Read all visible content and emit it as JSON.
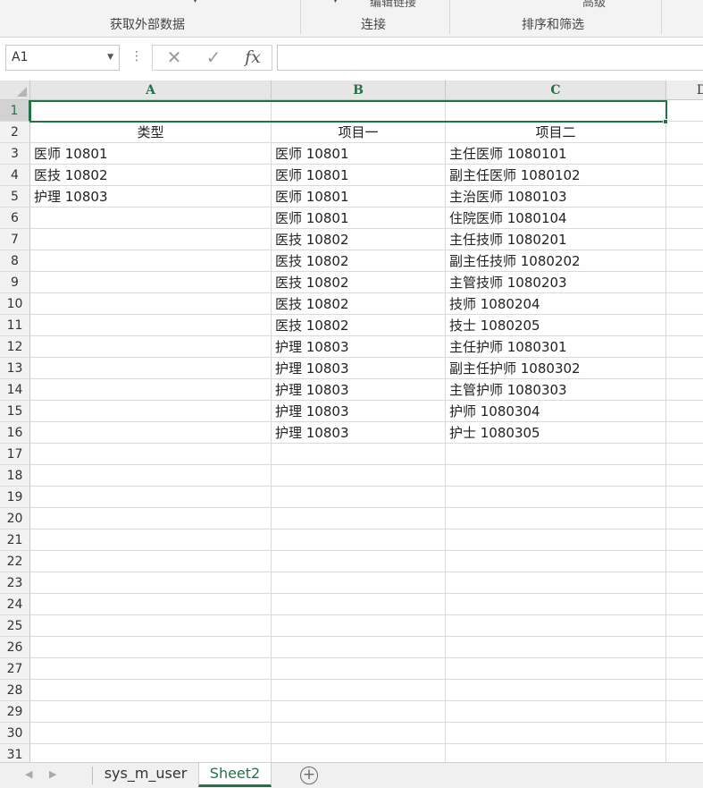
{
  "ribbon": {
    "groups": [
      {
        "label": "获取外部数据"
      },
      {
        "label": "连接"
      },
      {
        "label": "排序和筛选"
      }
    ],
    "cut_items": {
      "edit_links": "编辑链接",
      "advanced": "高级"
    }
  },
  "formula_bar": {
    "name_box": "A1",
    "cancel_icon": "close-icon",
    "enter_icon": "check-icon",
    "fx_label": "fx",
    "value": ""
  },
  "columns": [
    "A",
    "B",
    "C",
    "D"
  ],
  "rows": [
    {
      "num": "1",
      "A": "",
      "B": "",
      "C": ""
    },
    {
      "num": "2",
      "A": "类型",
      "B": "项目一",
      "C": "项目二"
    },
    {
      "num": "3",
      "A": "医师  10801",
      "B": "医师  10801",
      "C": "主任医师  1080101"
    },
    {
      "num": "4",
      "A": "医技  10802",
      "B": "医师  10801",
      "C": "副主任医师  1080102"
    },
    {
      "num": "5",
      "A": "护理  10803",
      "B": "医师  10801",
      "C": "主治医师  1080103"
    },
    {
      "num": "6",
      "A": "",
      "B": "医师  10801",
      "C": "住院医师  1080104"
    },
    {
      "num": "7",
      "A": "",
      "B": "医技  10802",
      "C": "主任技师  1080201"
    },
    {
      "num": "8",
      "A": "",
      "B": "医技  10802",
      "C": "副主任技师  1080202"
    },
    {
      "num": "9",
      "A": "",
      "B": "医技  10802",
      "C": "主管技师  1080203"
    },
    {
      "num": "10",
      "A": "",
      "B": "医技  10802",
      "C": "技师  1080204"
    },
    {
      "num": "11",
      "A": "",
      "B": "医技  10802",
      "C": "技士  1080205"
    },
    {
      "num": "12",
      "A": "",
      "B": "护理  10803",
      "C": "主任护师  1080301"
    },
    {
      "num": "13",
      "A": "",
      "B": "护理  10803",
      "C": "副主任护师  1080302"
    },
    {
      "num": "14",
      "A": "",
      "B": "护理  10803",
      "C": "主管护师  1080303"
    },
    {
      "num": "15",
      "A": "",
      "B": "护理  10803",
      "C": "护师  1080304"
    },
    {
      "num": "16",
      "A": "",
      "B": "护理  10803",
      "C": "护士  1080305"
    },
    {
      "num": "17",
      "A": "",
      "B": "",
      "C": ""
    },
    {
      "num": "18",
      "A": "",
      "B": "",
      "C": ""
    },
    {
      "num": "19",
      "A": "",
      "B": "",
      "C": ""
    },
    {
      "num": "20",
      "A": "",
      "B": "",
      "C": ""
    },
    {
      "num": "21",
      "A": "",
      "B": "",
      "C": ""
    },
    {
      "num": "22",
      "A": "",
      "B": "",
      "C": ""
    },
    {
      "num": "23",
      "A": "",
      "B": "",
      "C": ""
    },
    {
      "num": "24",
      "A": "",
      "B": "",
      "C": ""
    },
    {
      "num": "25",
      "A": "",
      "B": "",
      "C": ""
    },
    {
      "num": "26",
      "A": "",
      "B": "",
      "C": ""
    },
    {
      "num": "27",
      "A": "",
      "B": "",
      "C": ""
    },
    {
      "num": "28",
      "A": "",
      "B": "",
      "C": ""
    },
    {
      "num": "29",
      "A": "",
      "B": "",
      "C": ""
    },
    {
      "num": "30",
      "A": "",
      "B": "",
      "C": ""
    },
    {
      "num": "31",
      "A": "",
      "B": "",
      "C": ""
    }
  ],
  "sheet_tabs": [
    {
      "label": "sys_m_user",
      "active": false
    },
    {
      "label": "Sheet2",
      "active": true
    }
  ],
  "accent_color": "#217346"
}
